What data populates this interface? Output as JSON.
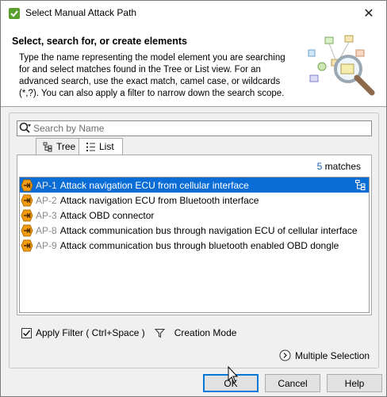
{
  "window": {
    "title": "Select Manual Attack Path",
    "close_glyph": "✕"
  },
  "header": {
    "title": "Select, search for, or create elements",
    "description": "Type the name representing the model element you are searching for and select matches found in the Tree or List view. For an advanced search, use the exact match, camel case, or wildcards (*,?). You can also apply a filter to narrow down the search scope."
  },
  "search": {
    "placeholder": "Search by Name",
    "value": ""
  },
  "tabs": [
    {
      "label": "Tree",
      "icon": "tree-icon",
      "active": false
    },
    {
      "label": "List",
      "icon": "list-icon",
      "active": true
    }
  ],
  "results": {
    "count": "5",
    "count_suffix": " matches",
    "items": [
      {
        "id": "AP-1",
        "name": "Attack navigation ECU from cellular interface",
        "selected": true,
        "icon": "attack-path-icon"
      },
      {
        "id": "AP-2",
        "name": "Attack navigation ECU from Bluetooth interface",
        "selected": false,
        "icon": "attack-path-icon"
      },
      {
        "id": "AP-3",
        "name": "Attack OBD connector",
        "selected": false,
        "icon": "attack-path-icon"
      },
      {
        "id": "AP-8",
        "name": "Attack communication bus through navigation ECU of cellular interface",
        "selected": false,
        "icon": "attack-path-icon"
      },
      {
        "id": "AP-9",
        "name": "Attack communication bus through bluetooth enabled OBD dongle",
        "selected": false,
        "icon": "attack-path-icon"
      }
    ]
  },
  "options": {
    "apply_filter_label": "Apply Filter ( Ctrl+Space )",
    "apply_filter_checked": true,
    "creation_mode_label": "Creation Mode",
    "multiple_selection_label": "Multiple Selection"
  },
  "buttons": {
    "ok": "OK",
    "cancel": "Cancel",
    "help": "Help"
  },
  "colors": {
    "selection": "#0a6dd6",
    "match_count": "#1a5fb4",
    "attack_icon": "#f39c12"
  }
}
